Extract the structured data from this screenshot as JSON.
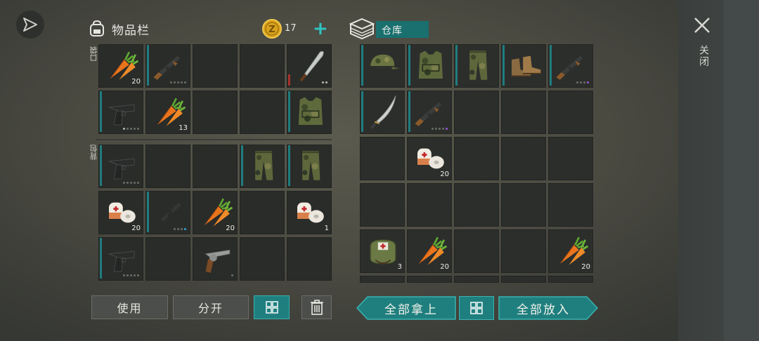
{
  "inventory": {
    "title": "物品栏",
    "coins": "17",
    "pockets_label": "口袋",
    "backpack_label": "背包",
    "slots": [
      {
        "item": "carrot",
        "qty": "20"
      },
      {
        "item": "ak-rifle",
        "dots": 5,
        "dots_on": 0
      },
      {
        "item": "empty"
      },
      {
        "item": "empty"
      },
      {
        "item": "machete",
        "dots": 2,
        "dots_on": 2,
        "bar": "red"
      },
      {
        "item": "pistol",
        "dots": 5,
        "dots_on": 1
      },
      {
        "item": "carrot",
        "qty": "13"
      },
      {
        "item": "empty"
      },
      {
        "item": "empty"
      },
      {
        "item": "camo-vest"
      },
      {
        "item": "pistol",
        "dots": 5,
        "dots_on": 0
      },
      {
        "item": "empty"
      },
      {
        "item": "empty"
      },
      {
        "item": "camo-pants"
      },
      {
        "item": "camo-pants"
      },
      {
        "item": "bandage",
        "qty": "20"
      },
      {
        "item": "m16-rifle",
        "dots": 3,
        "dots_on": 0,
        "extra": "blue"
      },
      {
        "item": "carrot",
        "qty": "20"
      },
      {
        "item": "empty"
      },
      {
        "item": "bandage",
        "qty": "1"
      },
      {
        "item": "pistol",
        "dots": 5,
        "dots_on": 0
      },
      {
        "item": "empty"
      },
      {
        "item": "revolver",
        "dots": 1,
        "dots_on": 0
      },
      {
        "item": "empty"
      },
      {
        "item": "empty"
      }
    ],
    "buttons": {
      "use": "使用",
      "split": "分开"
    }
  },
  "warehouse": {
    "title": "仓库",
    "slots": [
      {
        "item": "camo-cap"
      },
      {
        "item": "camo-vest"
      },
      {
        "item": "camo-pants"
      },
      {
        "item": "boots"
      },
      {
        "item": "ak-rifle",
        "dots": 3,
        "dots_on": 0,
        "extra": "purple"
      },
      {
        "item": "katana"
      },
      {
        "item": "ak-rifle",
        "dots": 4,
        "dots_on": 0,
        "extra": "purple"
      },
      {
        "item": "empty"
      },
      {
        "item": "empty"
      },
      {
        "item": "empty"
      },
      {
        "item": "empty"
      },
      {
        "item": "bandage",
        "qty": "20"
      },
      {
        "item": "empty"
      },
      {
        "item": "empty"
      },
      {
        "item": "empty"
      },
      {
        "item": "empty"
      },
      {
        "item": "empty"
      },
      {
        "item": "empty"
      },
      {
        "item": "empty"
      },
      {
        "item": "empty"
      },
      {
        "item": "medkit-bag",
        "qty": "3"
      },
      {
        "item": "carrot",
        "qty": "20"
      },
      {
        "item": "empty"
      },
      {
        "item": "empty"
      },
      {
        "item": "carrot",
        "qty": "20"
      }
    ],
    "buttons": {
      "take_all": "全部拿上",
      "put_all": "全部放入"
    }
  },
  "close_label": "关闭",
  "colors": {
    "accent": "#1f7f7f",
    "accent_border": "#39b3b0",
    "slot_bg": "#2a2c29"
  }
}
